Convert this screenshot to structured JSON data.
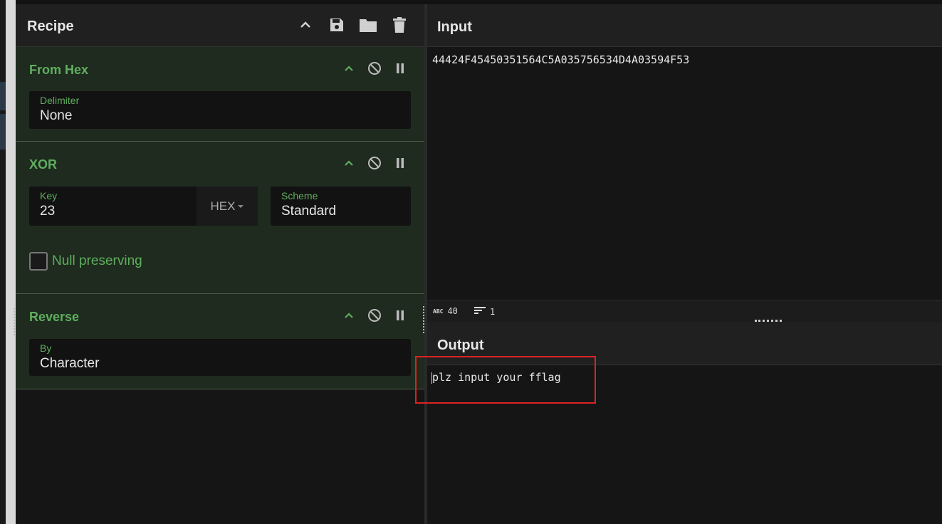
{
  "recipe": {
    "title": "Recipe",
    "header_icons": [
      "chevron-up-icon",
      "save-icon",
      "folder-icon",
      "trash-icon"
    ],
    "operations": [
      {
        "name": "From Hex",
        "fields": [
          {
            "label": "Delimiter",
            "value": "None"
          }
        ]
      },
      {
        "name": "XOR",
        "fields": [
          {
            "label": "Key",
            "value": "23",
            "encoding": "HEX"
          },
          {
            "label": "Scheme",
            "value": "Standard"
          }
        ],
        "checkbox": {
          "label": "Null preserving",
          "checked": false
        }
      },
      {
        "name": "Reverse",
        "fields": [
          {
            "label": "By",
            "value": "Character"
          }
        ]
      }
    ]
  },
  "input": {
    "title": "Input",
    "text": "44424F45450351564C5A035756534D4A03594F53"
  },
  "status": {
    "length": "40",
    "lines": "1"
  },
  "output": {
    "title": "Output",
    "text": "plz input your fflag"
  },
  "colors": {
    "accent_green": "#5fae5f",
    "operation_bg": "#1e2b1e",
    "highlight_red": "#dd2222"
  }
}
